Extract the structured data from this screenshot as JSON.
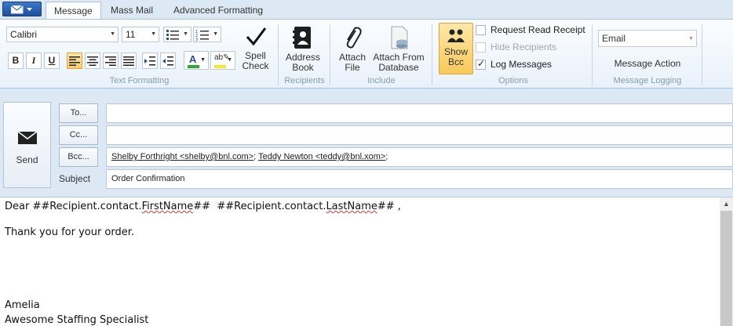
{
  "tabs": [
    "Message",
    "Mass Mail",
    "Advanced Formatting"
  ],
  "ribbon": {
    "font_name": "Calibri",
    "font_size": "11",
    "format_buttons": [
      "B",
      "I",
      "U"
    ],
    "groups": {
      "text_formatting": "Text Formatting",
      "recipients": "Recipients",
      "include": "Include",
      "options": "Options",
      "message_logging": "Message Logging"
    },
    "spell_check": [
      "Spell",
      "Check"
    ],
    "address_book": [
      "Address",
      "Book"
    ],
    "attach_file": [
      "Attach",
      "File"
    ],
    "attach_db": [
      "Attach From",
      "Database"
    ],
    "show_bcc": [
      "Show",
      "Bcc"
    ],
    "options": {
      "request_read_receipt": {
        "label": "Request Read Receipt",
        "checked": false,
        "enabled": true
      },
      "hide_recipients": {
        "label": "Hide Recipients",
        "checked": false,
        "enabled": false
      },
      "log_messages": {
        "label": "Log Messages",
        "checked": true,
        "enabled": true
      }
    },
    "logging_type": "Email",
    "message_action": "Message Action"
  },
  "header": {
    "send_label": "Send",
    "to_label": "To...",
    "cc_label": "Cc...",
    "bcc_label": "Bcc...",
    "subject_label": "Subject",
    "to_value": "",
    "cc_value": "",
    "bcc_recipients": [
      "Shelby Forthright <shelby@bnl.com>",
      "Teddy Newton <teddy@bnl.xom>"
    ],
    "subject_value": "Order Confirmation"
  },
  "body": {
    "greeting_prefix": "Dear ##Recipient.contact.",
    "greeting_first": "FirstName",
    "greeting_mid": "##  ##Recipient.contact.",
    "greeting_last": "LastName",
    "greeting_suffix": "## ,",
    "line2": "Thank you for your order.",
    "signature_name": "Amelia",
    "signature_title": "Awesome Staffing Specialist"
  }
}
